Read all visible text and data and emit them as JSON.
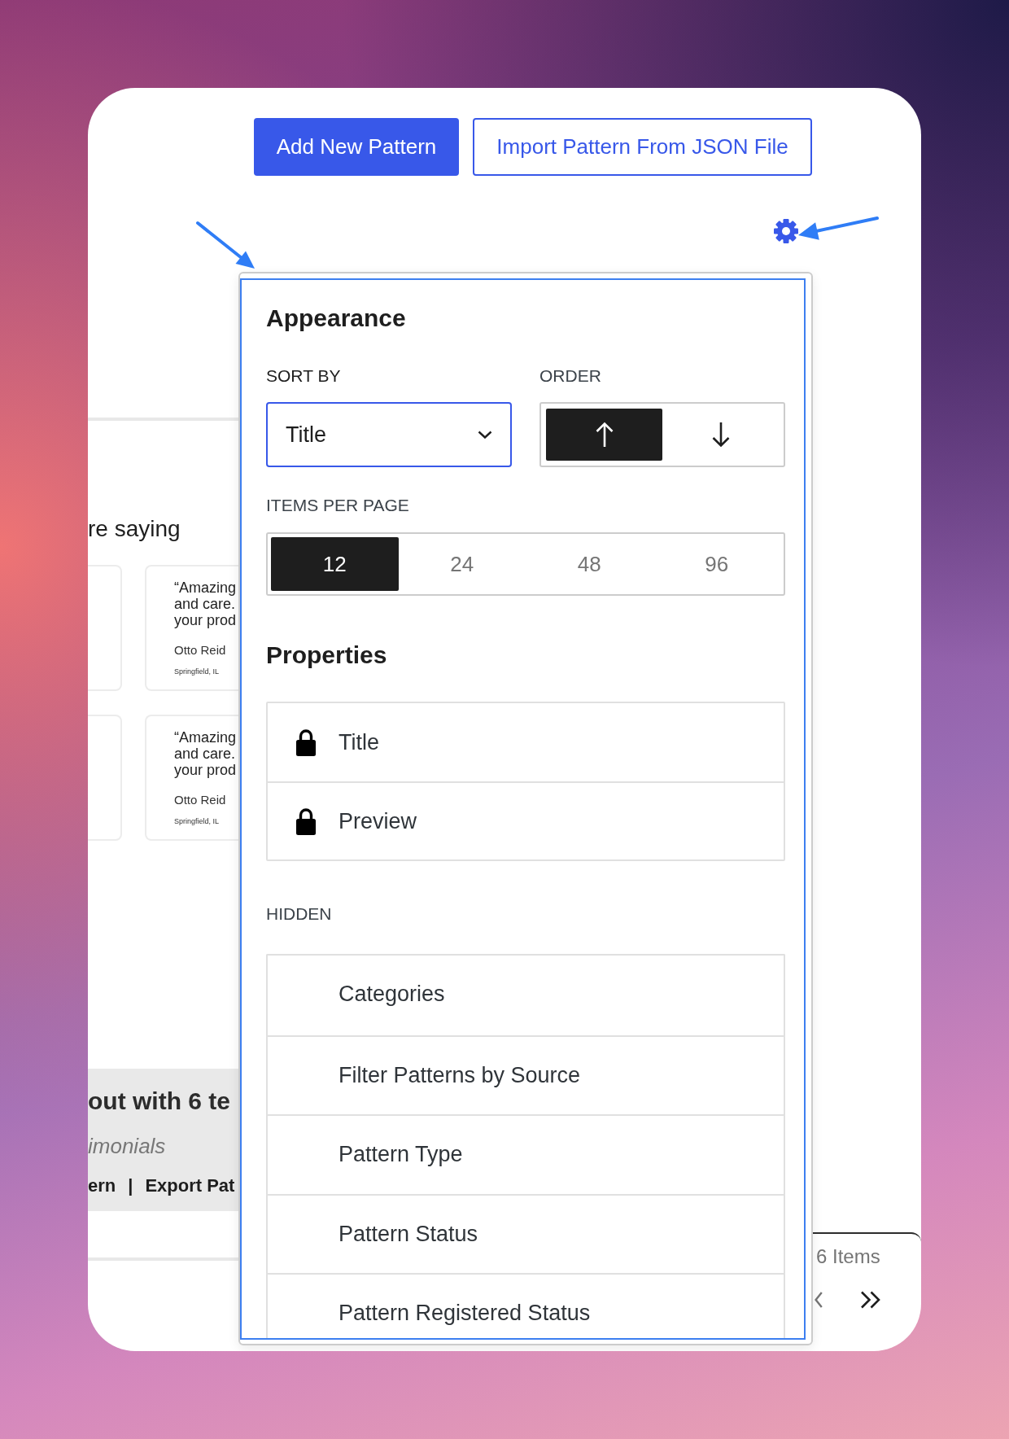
{
  "header_buttons": [
    {
      "kind": "primary",
      "label": "Add New Pattern"
    },
    {
      "kind": "secondary",
      "label": "Import Pattern From JSON File"
    }
  ],
  "background_content": {
    "section_heading": "re saying",
    "testimonials": [
      {
        "quote_lines": [
          "“Amazing",
          "and care.",
          "your prod"
        ],
        "name": "Otto Reid",
        "location": "Springfield, IL"
      },
      {
        "quote_lines": [
          "“Amazing",
          "and care.",
          "your prod"
        ],
        "name": "Otto Reid",
        "location": "Springfield, IL"
      }
    ],
    "pattern_card": {
      "title": "out with 6 te",
      "subtitle": "imonials",
      "actions": [
        "ern",
        "Export Pat"
      ],
      "separator": "|"
    }
  },
  "pagination": {
    "count": "6 Items"
  },
  "view_options": {
    "appearance": {
      "title": "Appearance",
      "sort_by": {
        "label": "SORT BY",
        "value": "Title"
      },
      "order": {
        "label": "ORDER",
        "options": [
          {
            "kind": "ascending",
            "selected": true
          },
          {
            "kind": "descending",
            "selected": false
          }
        ]
      },
      "items_per_page": {
        "label": "ITEMS PER PAGE",
        "options": [
          {
            "label": "12",
            "selected": true
          },
          {
            "label": "24",
            "selected": false
          },
          {
            "label": "48",
            "selected": false
          },
          {
            "label": "96",
            "selected": false
          }
        ]
      }
    },
    "properties": {
      "title": "Properties",
      "visible": [
        {
          "label": "Title",
          "locked": true
        },
        {
          "label": "Preview",
          "locked": true
        }
      ],
      "hidden_title": "HIDDEN",
      "hidden": [
        {
          "label": "Categories"
        },
        {
          "label": "Filter Patterns by Source"
        },
        {
          "label": "Pattern Type"
        },
        {
          "label": "Pattern Status"
        },
        {
          "label": "Pattern Registered Status"
        }
      ]
    }
  }
}
